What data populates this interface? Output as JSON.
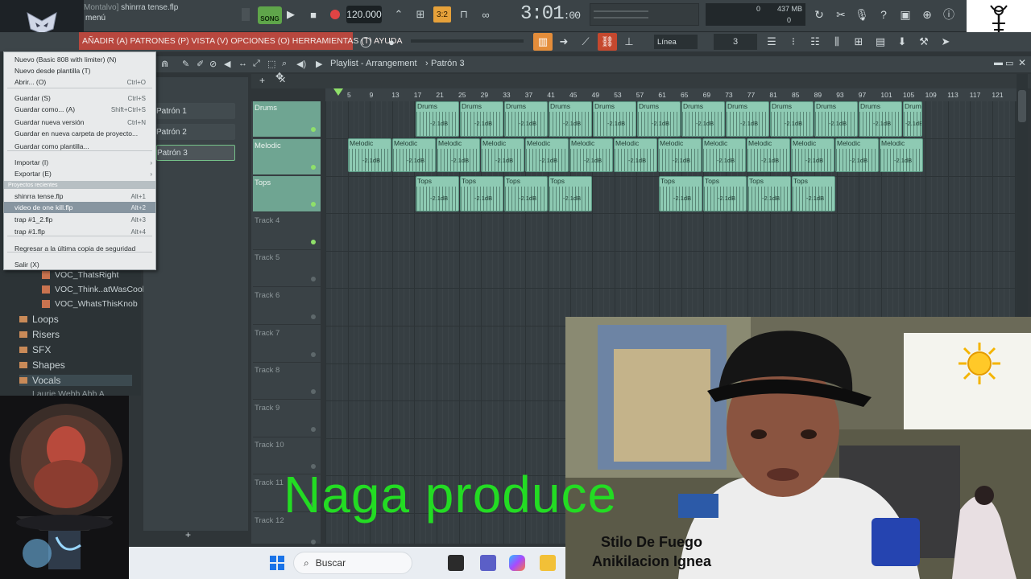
{
  "window": {
    "title_prefix": "Montalvo]",
    "title": "shinrra tense.flp",
    "menu_label": "menú",
    "tempo": "120.000",
    "song_mode": "SONG",
    "time_main": "3:01",
    "time_small": ":00",
    "snap_counter": "3:2",
    "cpu": {
      "voices": "0",
      "memory": "437 MB",
      "cpu": "0"
    }
  },
  "menubar": {
    "items": "AÑADIR (A) PATRONES (P) VISTA (V) OPCIONES (O) HERRAMIENTAS (T) AYUDA",
    "snap_mode": "Línea",
    "snap_value": "3"
  },
  "file_menu": {
    "items": [
      {
        "label": "Nuevo (Basic 808 with limiter) (N)",
        "shortcut": ""
      },
      {
        "label": "Nuevo desde plantilla (T)",
        "shortcut": ""
      },
      {
        "label": "Abrir... (O)",
        "shortcut": "Ctrl+O"
      },
      {
        "label": "Guardar (S)",
        "shortcut": "Ctrl+S"
      },
      {
        "label": "Guardar como... (A)",
        "shortcut": "Shift+Ctrl+S"
      },
      {
        "label": "Guardar nueva versión",
        "shortcut": "Ctrl+N"
      },
      {
        "label": "Guardar en nueva carpeta de proyecto...",
        "shortcut": ""
      },
      {
        "label": "Guardar como plantilla...",
        "shortcut": ""
      },
      {
        "label": "Importar (I)",
        "shortcut": ""
      },
      {
        "label": "Exportar (E)",
        "shortcut": ""
      },
      {
        "label": "shinrra tense.flp",
        "shortcut": "Alt+1"
      },
      {
        "label": "video de one kill.flp",
        "shortcut": "Alt+2"
      },
      {
        "label": "trap #1_2.flp",
        "shortcut": "Alt+3"
      },
      {
        "label": "trap #1.flp",
        "shortcut": "Alt+4"
      },
      {
        "label": "Regresar a la última copia de seguridad",
        "shortcut": ""
      },
      {
        "label": "Salir (X)",
        "shortcut": ""
      }
    ],
    "recent_header": "Proyectos recientes"
  },
  "browser": {
    "files": [
      "VOC_ThatsRight",
      "VOC_Think..atWasCool",
      "VOC_WhatsThisKnob"
    ],
    "folders": [
      "Loops",
      "Risers",
      "SFX",
      "Shapes",
      "Vocals"
    ],
    "partial": "Laurie Webb Abb A"
  },
  "patterns": [
    "Patrón 1",
    "Patrón 2",
    "Patrón 3"
  ],
  "playlist": {
    "title": "Playlist - Arrangement",
    "pattern": "Patrón 3",
    "ruler": [
      "5",
      "9",
      "13",
      "17",
      "21",
      "25",
      "29",
      "33",
      "37",
      "41",
      "45",
      "49",
      "53",
      "57",
      "61",
      "65",
      "69",
      "73",
      "77",
      "81",
      "85",
      "89",
      "93",
      "97",
      "101",
      "105",
      "109",
      "113",
      "117",
      "121"
    ],
    "tracks": [
      "Drums",
      "Melodic",
      "Tops",
      "Track 4",
      "Track 5",
      "Track 6",
      "Track 7",
      "Track 8",
      "Track 9",
      "Track 10",
      "Track 11",
      "Track 12"
    ],
    "clip_db": "-2.1dB",
    "clip_names": {
      "drums": "Drums",
      "melodic": "Melodic",
      "tops": "Tops"
    }
  },
  "overlay": {
    "brand": "Naga produce",
    "caption1": "Stilo De Fuego",
    "caption2": "Anikilacion Ignea"
  },
  "taskbar": {
    "search_placeholder": "Buscar"
  },
  "colors": {
    "accent": "#e6a13a",
    "clip": "#8ecab3",
    "track_active": "#6fa592",
    "menu_red": "#b8473e",
    "brand_green": "#23dc23"
  }
}
